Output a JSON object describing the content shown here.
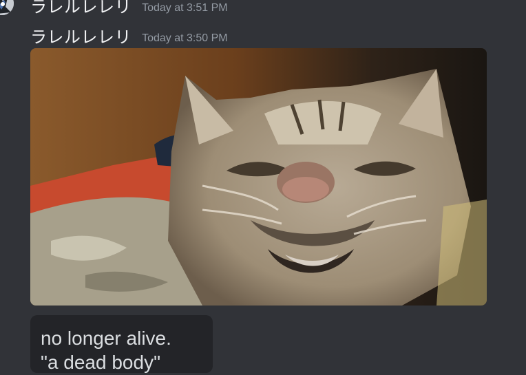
{
  "messages": [
    {
      "username": "ラレルレレリ",
      "timestamp": "Today at 3:51 PM"
    },
    {
      "username": "ラレルレレリ",
      "timestamp": "Today at 3:50 PM",
      "attachment": {
        "type": "image",
        "subject": "cat-photo"
      },
      "text_image": {
        "lines": [
          "no longer alive.",
          "\"a dead body\""
        ]
      }
    }
  ],
  "colors": {
    "background": "#313338",
    "username": "#f2f3f5",
    "timestamp": "#949ba4",
    "card_background": "#232428",
    "card_text": "#dbdee1"
  }
}
